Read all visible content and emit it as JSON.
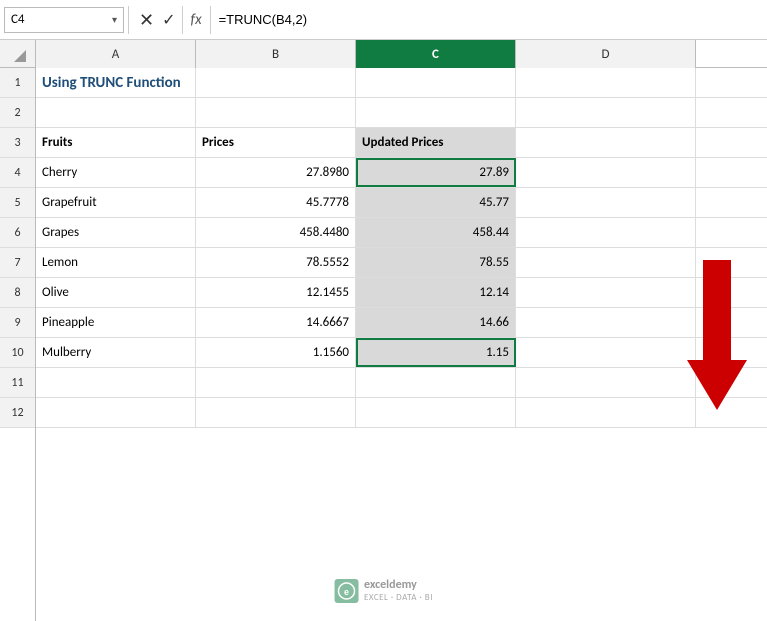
{
  "namebox": {
    "value": "C4",
    "chevron": "▾"
  },
  "formula": {
    "fx_label": "fx",
    "value": "=TRUNC(B4,2)"
  },
  "columns": {
    "headers": [
      "",
      "A",
      "B",
      "C",
      "D"
    ]
  },
  "rows": [
    {
      "num": "1",
      "cells": [
        "Using TRUNC Function",
        "",
        ""
      ]
    },
    {
      "num": "2",
      "cells": [
        "",
        "",
        ""
      ]
    },
    {
      "num": "3",
      "cells": [
        "Fruits",
        "Prices",
        "Updated Prices"
      ]
    },
    {
      "num": "4",
      "cells": [
        "Cherry",
        "27.8980",
        "27.89"
      ]
    },
    {
      "num": "5",
      "cells": [
        "Grapefruit",
        "45.7778",
        "45.77"
      ]
    },
    {
      "num": "6",
      "cells": [
        "Grapes",
        "458.4480",
        "458.44"
      ]
    },
    {
      "num": "7",
      "cells": [
        "Lemon",
        "78.5552",
        "78.55"
      ]
    },
    {
      "num": "8",
      "cells": [
        "Olive",
        "12.1455",
        "12.14"
      ]
    },
    {
      "num": "9",
      "cells": [
        "Pineapple",
        "14.6667",
        "14.66"
      ]
    },
    {
      "num": "10",
      "cells": [
        "Mulberry",
        "1.1560",
        "1.15"
      ]
    },
    {
      "num": "11",
      "cells": [
        "",
        "",
        ""
      ]
    },
    {
      "num": "12",
      "cells": [
        "",
        "",
        ""
      ]
    }
  ],
  "watermark": {
    "logo": "e",
    "line1": "exceldemy",
    "line2": "EXCEL · DATA · BI"
  }
}
